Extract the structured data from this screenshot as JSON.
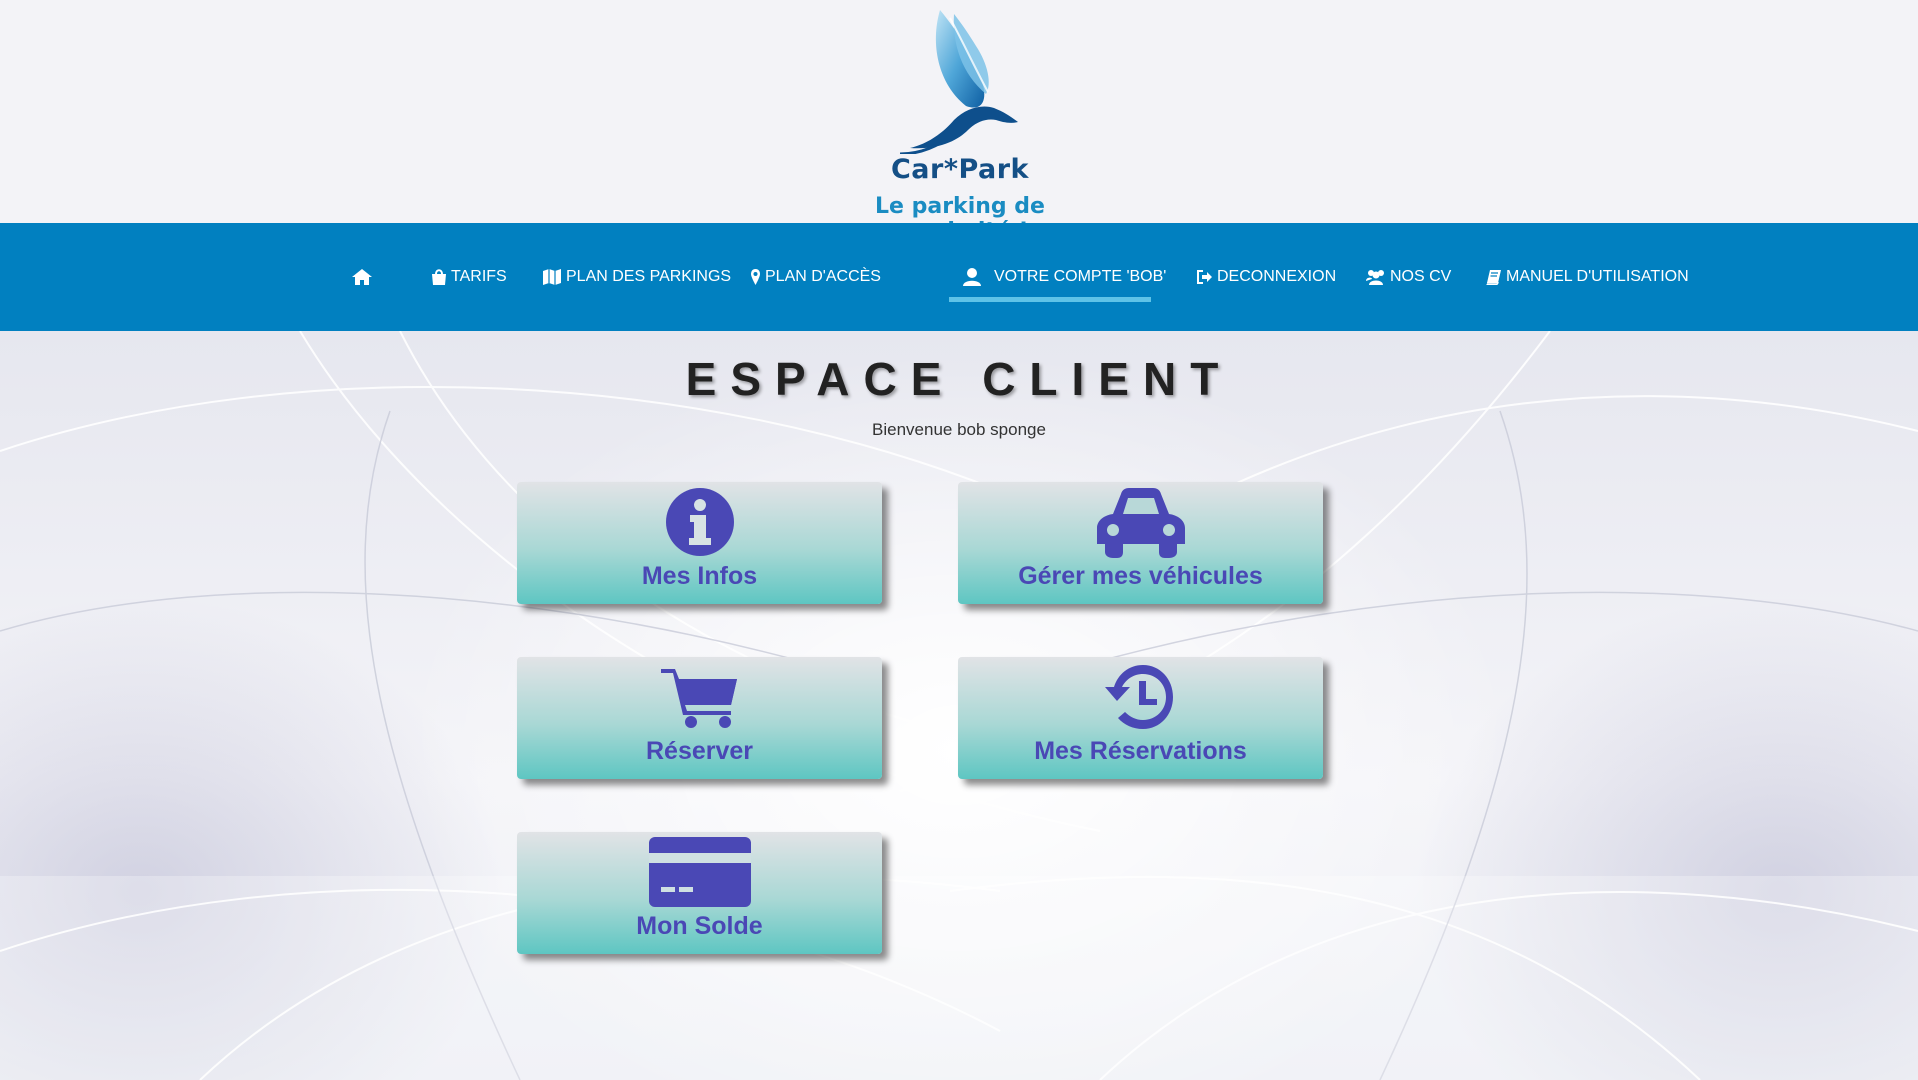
{
  "brand": {
    "name": "Car*Park",
    "tagline": "Le parking de proximité !"
  },
  "nav": {
    "items": [
      {
        "label": "",
        "icon": "home-icon"
      },
      {
        "label": "TARIFS",
        "icon": "shopping-bag-icon"
      },
      {
        "label": "PLAN DES PARKINGS",
        "icon": "map-icon"
      },
      {
        "label": "PLAN D'ACCÈS",
        "icon": "map-marker-icon"
      },
      {
        "label": "VOTRE COMPTE 'BOB'",
        "icon": "user-icon",
        "active": true
      },
      {
        "label": "DECONNEXION",
        "icon": "sign-out-icon"
      },
      {
        "label": "NOS CV",
        "icon": "users-icon"
      },
      {
        "label": "MANUEL D'UTILISATION",
        "icon": "book-icon"
      }
    ]
  },
  "page": {
    "title": "ESPACE CLIENT",
    "welcome": "Bienvenue bob sponge"
  },
  "tiles": [
    {
      "label": "Mes Infos",
      "icon": "info-circle-icon"
    },
    {
      "label": "Gérer mes véhicules",
      "icon": "car-icon"
    },
    {
      "label": "Réserver",
      "icon": "shopping-cart-icon"
    },
    {
      "label": "Mes Réservations",
      "icon": "history-icon"
    },
    {
      "label": "Mon Solde",
      "icon": "credit-card-icon"
    }
  ],
  "colors": {
    "navbar": "#0180c0",
    "tile_text": "#4a48b5",
    "brand_dark": "#144f86",
    "brand_light": "#1a8cc2"
  }
}
